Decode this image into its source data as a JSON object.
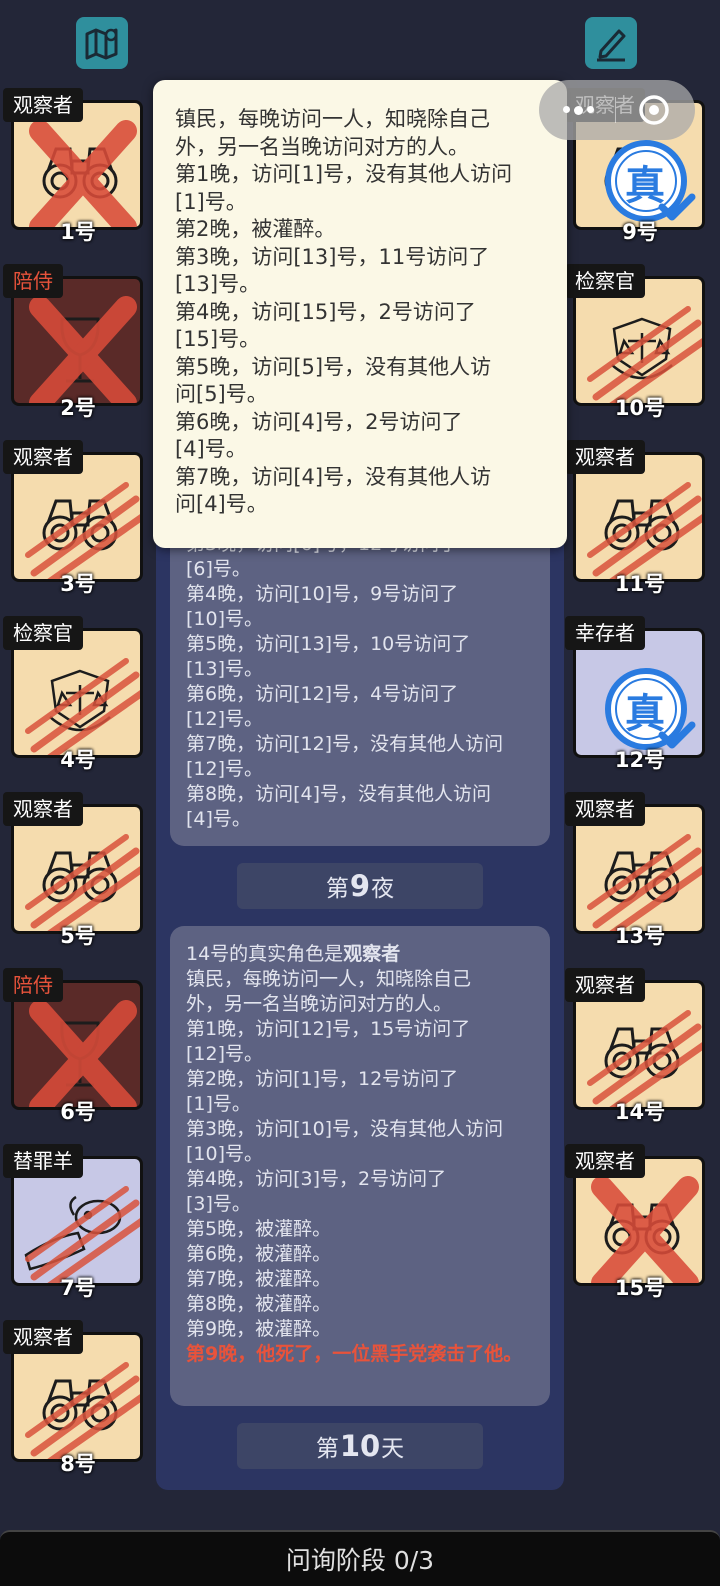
{
  "top_bar": {
    "map_icon": "map-icon",
    "notes_icon": "pen-note-icon"
  },
  "colors": {
    "background": "#232638",
    "center_panel": "#2c3562",
    "card": "#f5dcae",
    "popup": "#fbf8e6",
    "accent_red": "#e8533b",
    "badge_blue": "#2a7be0"
  },
  "players_left": [
    {
      "number": "1号",
      "role": "观察者",
      "state": "crossed"
    },
    {
      "number": "2号",
      "role": "陪侍",
      "state": "dead-crossed"
    },
    {
      "number": "3号",
      "role": "观察者",
      "state": "clawed"
    },
    {
      "number": "4号",
      "role": "检察官",
      "state": "clawed"
    },
    {
      "number": "5号",
      "role": "观察者",
      "state": "clawed"
    },
    {
      "number": "6号",
      "role": "陪侍",
      "state": "dead-crossed"
    },
    {
      "number": "7号",
      "role": "替罪羊",
      "state": "clawed"
    },
    {
      "number": "8号",
      "role": "观察者",
      "state": "clawed"
    }
  ],
  "players_right": [
    {
      "number": "9号",
      "role": "观察者",
      "state": "verified"
    },
    {
      "number": "10号",
      "role": "检察官",
      "state": "clawed"
    },
    {
      "number": "11号",
      "role": "观察者",
      "state": "clawed"
    },
    {
      "number": "12号",
      "role": "幸存者",
      "state": "verified"
    },
    {
      "number": "13号",
      "role": "观察者",
      "state": "clawed"
    },
    {
      "number": "14号",
      "role": "观察者",
      "state": "clawed"
    },
    {
      "number": "15号",
      "role": "观察者",
      "state": "crossed"
    }
  ],
  "verified_badge": "真",
  "popup": {
    "lines": [
      "镇民，每晚访问一人，知晓除自己",
      "外，另一名当晚访问对方的人。",
      "第1晚，访问[1]号，没有其他人访问",
      "[1]号。",
      "第2晚，被灌醉。",
      "第3晚，访问[13]号，11号访问了",
      "[13]号。",
      "第4晚，访问[15]号，2号访问了",
      "[15]号。",
      "第5晚，访问[5]号，没有其他人访",
      "问[5]号。",
      "第6晚，访问[4]号，2号访问了",
      "[4]号。",
      "第7晚，访问[4]号，没有其他人访",
      "问[4]号。"
    ]
  },
  "log_card_1": {
    "lines": [
      "第3晚，访问[6]号，12号访问了",
      "[6]号。",
      "第4晚，访问[10]号，9号访问了",
      "[10]号。",
      "第5晚，访问[13]号，10号访问了",
      "[13]号。",
      "第6晚，访问[12]号，4号访问了",
      "[12]号。",
      "第7晚，访问[12]号，没有其他人访问",
      "[12]号。",
      "第8晚，访问[4]号，没有其他人访问",
      "[4]号。"
    ]
  },
  "phase_night": {
    "prefix": "第",
    "number": "9",
    "suffix": "夜"
  },
  "log_card_2": {
    "heading_prefix": "14号的真实角色是",
    "heading_role": "观察者",
    "lines": [
      "镇民，每晚访问一人，知晓除自己",
      "外，另一名当晚访问对方的人。",
      "第1晚，访问[12]号，15号访问了",
      "[12]号。",
      "第2晚，访问[1]号，12号访问了",
      "[1]号。",
      "第3晚，访问[10]号，没有其他人访问",
      "[10]号。",
      "第4晚，访问[3]号，2号访问了",
      "[3]号。",
      "第5晚，被灌醉。",
      "第6晚，被灌醉。",
      "第7晚，被灌醉。",
      "第8晚，被灌醉。",
      "第9晚，被灌醉。"
    ],
    "death_note": "第9晚，他死了，一位黑手党袭击了他。"
  },
  "phase_day": {
    "prefix": "第",
    "number": "10",
    "suffix": "天"
  },
  "bottom_bar": {
    "label": "问询阶段 0/3"
  },
  "capsule": {
    "more_icon": "more-dots-icon",
    "close_icon": "target-close-icon"
  }
}
